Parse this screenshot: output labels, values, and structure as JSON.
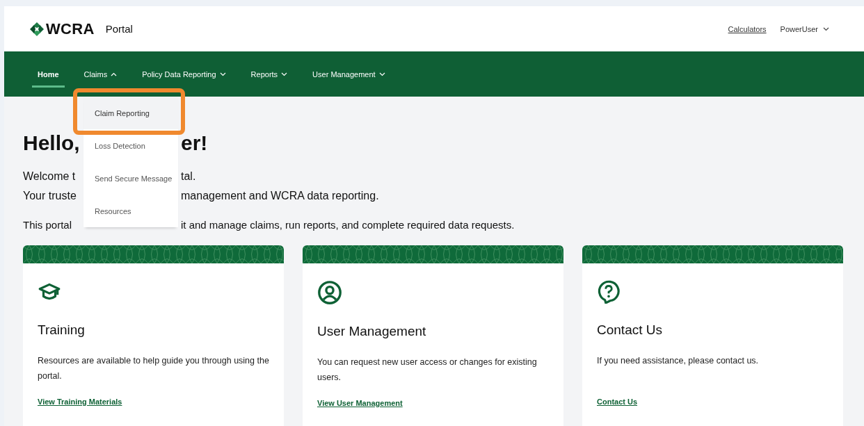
{
  "header": {
    "logo": "WCRA",
    "product": "Portal",
    "links": [
      {
        "label": "Calculators",
        "kind": "link"
      },
      {
        "label": "PowerUser",
        "kind": "menu"
      }
    ]
  },
  "nav": [
    {
      "label": "Home",
      "kind": "link",
      "selected": true
    },
    {
      "label": "Claims",
      "kind": "menu",
      "selected": false,
      "expanded": true
    },
    {
      "label": "Policy Data Reporting",
      "kind": "menu",
      "selected": false,
      "expanded": false
    },
    {
      "label": "Reports",
      "kind": "menu",
      "selected": false,
      "expanded": false
    },
    {
      "label": "User Management",
      "kind": "menu",
      "selected": false,
      "expanded": false
    }
  ],
  "dropdown": {
    "items": [
      {
        "label": "Claim Reporting",
        "selected": true
      },
      {
        "label": "Loss Detection",
        "selected": false
      },
      {
        "label": "Send Secure Message",
        "selected": false
      },
      {
        "label": "Resources",
        "selected": false
      }
    ],
    "highlighted": true
  },
  "intro": [
    {
      "kind": "heading",
      "left": "Hello,",
      "right": "er!"
    },
    {
      "kind": "lead",
      "left": "Welcome t",
      "right": "tal."
    },
    {
      "kind": "lead",
      "left": "Your truste",
      "right": "management and WCRA data reporting."
    },
    {
      "kind": "body",
      "left": "This portal",
      "right": "it and manage claims, run reports, and complete required data requests."
    }
  ],
  "cards": [
    {
      "title": "Training",
      "text": "Resources are available to help guide you through using the portal.",
      "link": "View Training Materials"
    },
    {
      "title": "User Management",
      "text": "You can request new user access or changes for existing users.",
      "link": "View User Management"
    },
    {
      "title": "Contact Us",
      "text": "If you need assistance, please contact us.",
      "link": "Contact Us"
    }
  ]
}
